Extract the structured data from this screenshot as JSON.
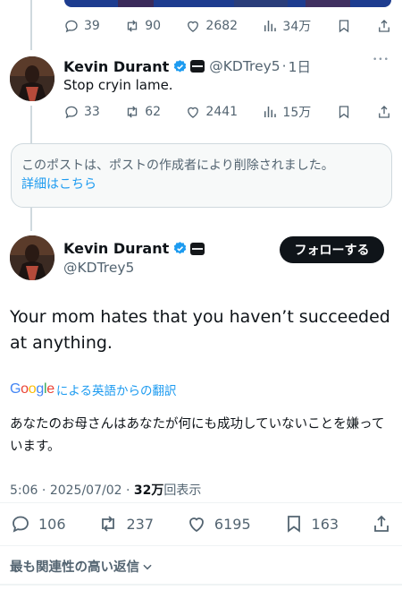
{
  "previous_tweet": {
    "replies": "39",
    "retweets": "90",
    "likes": "2682",
    "views": "34万"
  },
  "reply_tweet": {
    "display_name": "Kevin Durant",
    "handle": "@KDTrey5",
    "separator": "·",
    "time": "1日",
    "text": "Stop cryin lame.",
    "more": "•••",
    "replies": "33",
    "retweets": "62",
    "likes": "2441",
    "views": "15万"
  },
  "deleted_notice": {
    "text": "このポストは、ポストの作成者により削除されました。",
    "link": "詳細はこちら"
  },
  "main_tweet": {
    "display_name": "Kevin Durant",
    "handle": "@KDTrey5",
    "follow_label": "フォローする",
    "text": "Your mom hates that you haven’t succeeded at anything.",
    "google_logo": "Google",
    "translate_label": "による英語からの翻訳",
    "translated_text": "あなたのお母さんはあなたが何にも成功していないことを嫌っています。",
    "time": "5:06",
    "date_separator": "·",
    "date": "2025/07/02",
    "views_count": "32万",
    "views_label": "回表示",
    "replies": "106",
    "retweets": "237",
    "likes": "6195",
    "bookmarks": "163"
  },
  "sort": {
    "label": "最も関連性の高い返信"
  },
  "colors": {
    "accent": "#1d9bf0",
    "text": "#0f1419",
    "muted": "#536471",
    "border": "#cfd9de"
  }
}
